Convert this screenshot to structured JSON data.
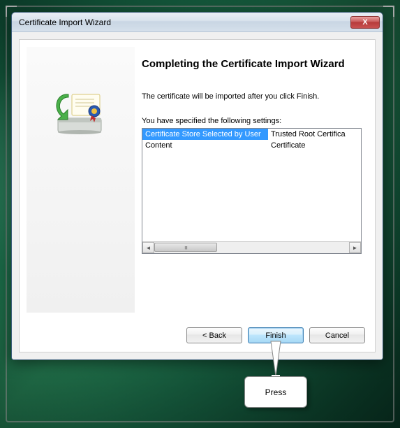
{
  "window": {
    "title": "Certificate Import Wizard"
  },
  "main": {
    "heading": "Completing the Certificate Import Wizard",
    "subtext": "The certificate will be imported after you click Finish.",
    "settings_label": "You have specified the following settings:",
    "rows": [
      {
        "key": "Certificate Store Selected by User",
        "value": "Trusted Root Certifica"
      },
      {
        "key": "Content",
        "value": "Certificate"
      }
    ]
  },
  "buttons": {
    "back": "< Back",
    "finish": "Finish",
    "cancel": "Cancel"
  },
  "icons": {
    "close": "X",
    "left_arrow": "◄",
    "right_arrow": "►",
    "grip": "ııı"
  },
  "callout": {
    "text": "Press"
  }
}
